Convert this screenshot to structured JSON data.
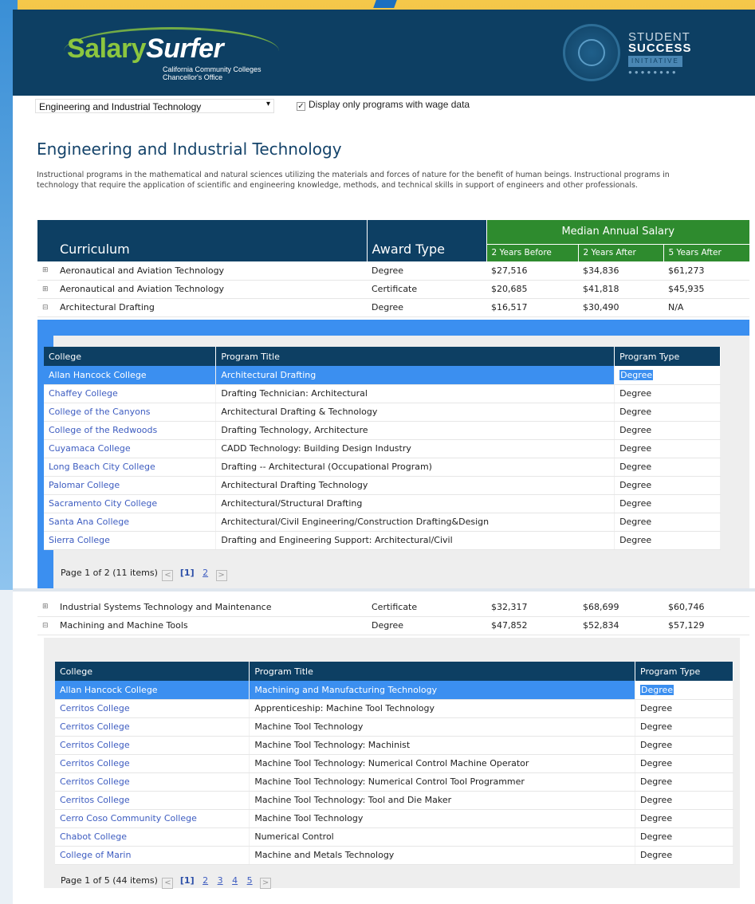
{
  "header": {
    "logo_part1": "Salary",
    "logo_part2": "Surfer",
    "logo_sub1": "California Community Colleges",
    "logo_sub2": "Chancellor's Office",
    "ssi_line1": "STUDENT",
    "ssi_line2": "SUCCESS",
    "ssi_line3": "INITIATIVE"
  },
  "filters": {
    "program_select": "Engineering and Industrial Technology",
    "checkbox_label": "Display only programs with wage data",
    "checkbox_checked": true
  },
  "page_title": "Engineering and Industrial Technology",
  "description": "Instructional programs in the mathematical and natural sciences utilizing the materials and forces of nature for the benefit of human beings. Instructional programs in technology that require the application of scientific and engineering knowledge, methods, and technical skills in support of engineers and other professionals.",
  "main_table": {
    "col_curriculum": "Curriculum",
    "col_award": "Award Type",
    "col_median": "Median Annual Salary",
    "col_2before": "2 Years Before",
    "col_2after": "2 Years After",
    "col_5after": "5 Years After",
    "rows_top": [
      {
        "exp": "⊞",
        "curriculum": "Aeronautical and Aviation Technology",
        "award": "Degree",
        "before2": "$27,516",
        "after2": "$34,836",
        "after5": "$61,273"
      },
      {
        "exp": "⊞",
        "curriculum": "Aeronautical and Aviation Technology",
        "award": "Certificate",
        "before2": "$20,685",
        "after2": "$41,818",
        "after5": "$45,935"
      },
      {
        "exp": "⊟",
        "curriculum": "Architectural Drafting",
        "award": "Degree",
        "before2": "$16,517",
        "after2": "$30,490",
        "after5": "N/A"
      }
    ],
    "rows_bottom": [
      {
        "exp": "⊞",
        "curriculum": "Industrial Systems Technology and Maintenance",
        "award": "Certificate",
        "before2": "$32,317",
        "after2": "$68,699",
        "after5": "$60,746"
      },
      {
        "exp": "⊟",
        "curriculum": "Machining and Machine Tools",
        "award": "Degree",
        "before2": "$47,852",
        "after2": "$52,834",
        "after5": "$57,129"
      }
    ]
  },
  "detail1": {
    "col_college": "College",
    "col_title": "Program Title",
    "col_type": "Program Type",
    "rows": [
      {
        "college": "Allan Hancock College",
        "title": "Architectural Drafting",
        "type": "Degree"
      },
      {
        "college": "Chaffey College",
        "title": "Drafting Technician: Architectural",
        "type": "Degree"
      },
      {
        "college": "College of the Canyons",
        "title": "Architectural Drafting & Technology",
        "type": "Degree"
      },
      {
        "college": "College of the Redwoods",
        "title": "Drafting Technology, Architecture",
        "type": "Degree"
      },
      {
        "college": "Cuyamaca College",
        "title": "CADD Technology: Building Design Industry",
        "type": "Degree"
      },
      {
        "college": "Long Beach City College",
        "title": "Drafting -- Architectural (Occupational Program)",
        "type": "Degree"
      },
      {
        "college": "Palomar College",
        "title": "Architectural Drafting Technology",
        "type": "Degree"
      },
      {
        "college": "Sacramento City College",
        "title": "Architectural/Structural Drafting",
        "type": "Degree"
      },
      {
        "college": "Santa Ana College",
        "title": "Architectural/Civil Engineering/Construction Drafting&Design",
        "type": "Degree"
      },
      {
        "college": "Sierra College",
        "title": "Drafting and Engineering Support: Architectural/Civil",
        "type": "Degree"
      }
    ],
    "pager_text": "Page 1 of 2 (11 items)",
    "prev": "<",
    "current": "[1]",
    "pages": [
      "2"
    ],
    "next": ">"
  },
  "detail2": {
    "col_college": "College",
    "col_title": "Program Title",
    "col_type": "Program Type",
    "rows": [
      {
        "college": "Allan Hancock College",
        "title": "Machining and Manufacturing Technology",
        "type": "Degree"
      },
      {
        "college": "Cerritos College",
        "title": "Apprenticeship: Machine Tool Technology",
        "type": "Degree"
      },
      {
        "college": "Cerritos College",
        "title": "Machine Tool Technology",
        "type": "Degree"
      },
      {
        "college": "Cerritos College",
        "title": "Machine Tool Technology: Machinist",
        "type": "Degree"
      },
      {
        "college": "Cerritos College",
        "title": "Machine Tool Technology: Numerical Control Machine Operator",
        "type": "Degree"
      },
      {
        "college": "Cerritos College",
        "title": "Machine Tool Technology: Numerical Control Tool Programmer",
        "type": "Degree"
      },
      {
        "college": "Cerritos College",
        "title": "Machine Tool Technology: Tool and Die Maker",
        "type": "Degree"
      },
      {
        "college": "Cerro Coso Community College",
        "title": "Machine Tool Technology",
        "type": "Degree"
      },
      {
        "college": "Chabot College",
        "title": "Numerical Control",
        "type": "Degree"
      },
      {
        "college": "College of Marin",
        "title": "Machine and Metals Technology",
        "type": "Degree"
      }
    ],
    "pager_text": "Page 1 of 5 (44 items)",
    "prev": "<",
    "current": "[1]",
    "pages": [
      "2",
      "3",
      "4",
      "5"
    ],
    "next": ">"
  },
  "colors": {
    "header_navy": "#0d3f63",
    "salary_green": "#2e8b2e",
    "selection_blue": "#3b8ff0",
    "link_blue": "#3d5cc0",
    "logo_green": "#8cc63f"
  }
}
